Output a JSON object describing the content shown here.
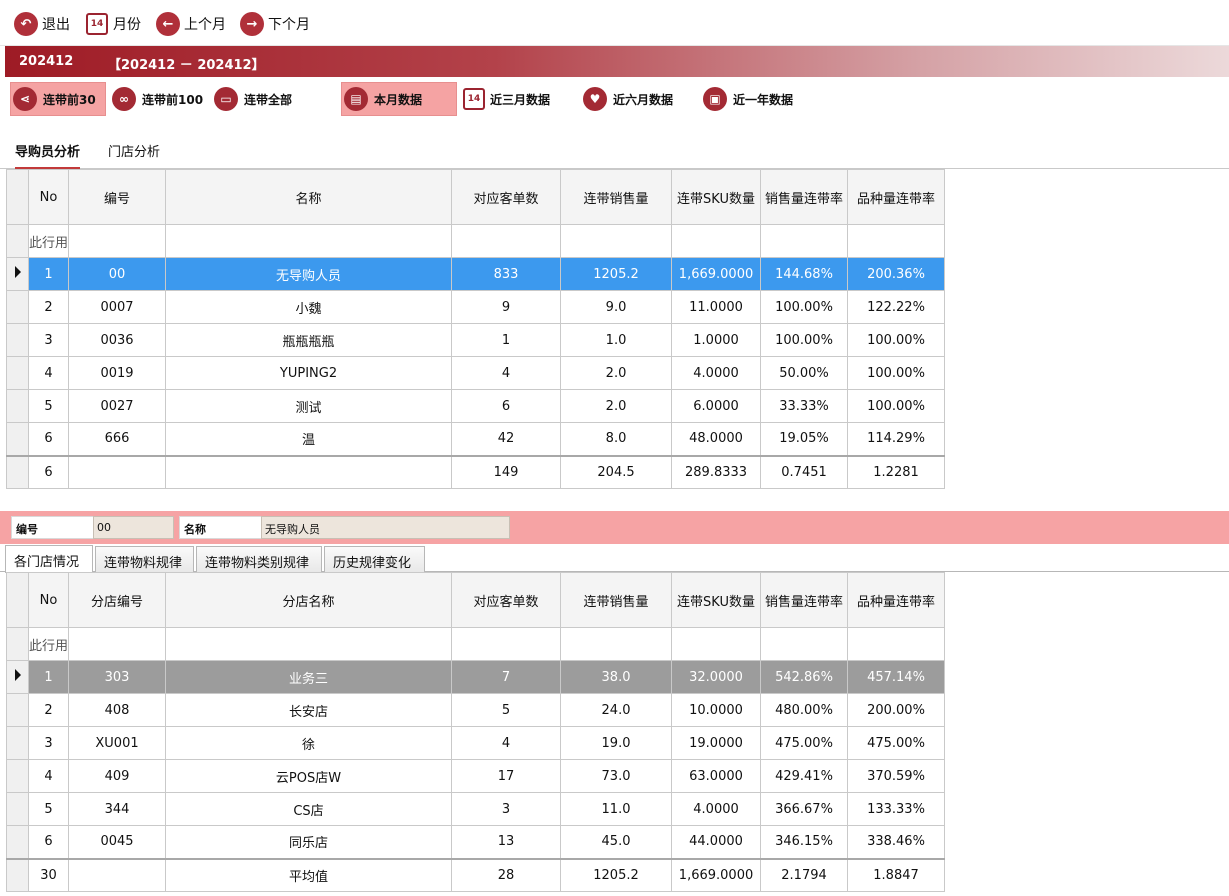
{
  "toolbar": {
    "exit_label": "退出",
    "month_label": "月份",
    "prev_label": "上个月",
    "next_label": "下个月",
    "calendar_day": "14"
  },
  "period": {
    "current": "202412",
    "range": "【202412 － 202412】"
  },
  "filters": {
    "top30": "连带前30",
    "top100": "连带前100",
    "all": "连带全部",
    "this_month": "本月数据",
    "three_months": "近三月数据",
    "six_months": "近六月数据",
    "one_year": "近一年数据"
  },
  "tabs": {
    "guide": "导购员分析",
    "store": "门店分析"
  },
  "grid1": {
    "headers": [
      "No",
      "编号",
      "名称",
      "对应客单数",
      "连带销售量",
      "连带SKU数量",
      "销售量连带率",
      "品种量连带率"
    ],
    "filter_text": "此行用",
    "rows": [
      [
        "1",
        "00",
        "无导购人员",
        "833",
        "1205.2",
        "1,669.0000",
        "144.68%",
        "200.36%"
      ],
      [
        "2",
        "0007",
        "小魏",
        "9",
        "9.0",
        "11.0000",
        "100.00%",
        "122.22%"
      ],
      [
        "3",
        "0036",
        "瓶瓶瓶瓶",
        "1",
        "1.0",
        "1.0000",
        "100.00%",
        "100.00%"
      ],
      [
        "4",
        "0019",
        "YUPING2",
        "4",
        "2.0",
        "4.0000",
        "50.00%",
        "100.00%"
      ],
      [
        "5",
        "0027",
        "测试",
        "6",
        "2.0",
        "6.0000",
        "33.33%",
        "100.00%"
      ],
      [
        "6",
        "666",
        "温",
        "42",
        "8.0",
        "48.0000",
        "19.05%",
        "114.29%"
      ]
    ],
    "total": [
      "6",
      "",
      "",
      "149",
      "204.5",
      "289.8333",
      "0.7451",
      "1.2281"
    ]
  },
  "detail": {
    "code_label": "编号",
    "code_value": "00",
    "name_label": "名称",
    "name_value": "无导购人员"
  },
  "tabs2": {
    "store_status": "各门店情况",
    "material_rule": "连带物料规律",
    "category_rule": "连带物料类别规律",
    "history_change": "历史规律变化"
  },
  "grid2": {
    "headers": [
      "No",
      "分店编号",
      "分店名称",
      "对应客单数",
      "连带销售量",
      "连带SKU数量",
      "销售量连带率",
      "品种量连带率"
    ],
    "filter_text": "此行用",
    "rows": [
      [
        "1",
        "303",
        "业务三",
        "7",
        "38.0",
        "32.0000",
        "542.86%",
        "457.14%"
      ],
      [
        "2",
        "408",
        "长安店",
        "5",
        "24.0",
        "10.0000",
        "480.00%",
        "200.00%"
      ],
      [
        "3",
        "XU001",
        "徐",
        "4",
        "19.0",
        "19.0000",
        "475.00%",
        "475.00%"
      ],
      [
        "4",
        "409",
        "云POS店W",
        "17",
        "73.0",
        "63.0000",
        "429.41%",
        "370.59%"
      ],
      [
        "5",
        "344",
        "CS店",
        "3",
        "11.0",
        "4.0000",
        "366.67%",
        "133.33%"
      ],
      [
        "6",
        "0045",
        "同乐店",
        "13",
        "45.0",
        "44.0000",
        "346.15%",
        "338.46%"
      ]
    ],
    "total": [
      "30",
      "",
      "平均值",
      "28",
      "1205.2",
      "1,669.0000",
      "2.1794",
      "1.8847"
    ]
  }
}
